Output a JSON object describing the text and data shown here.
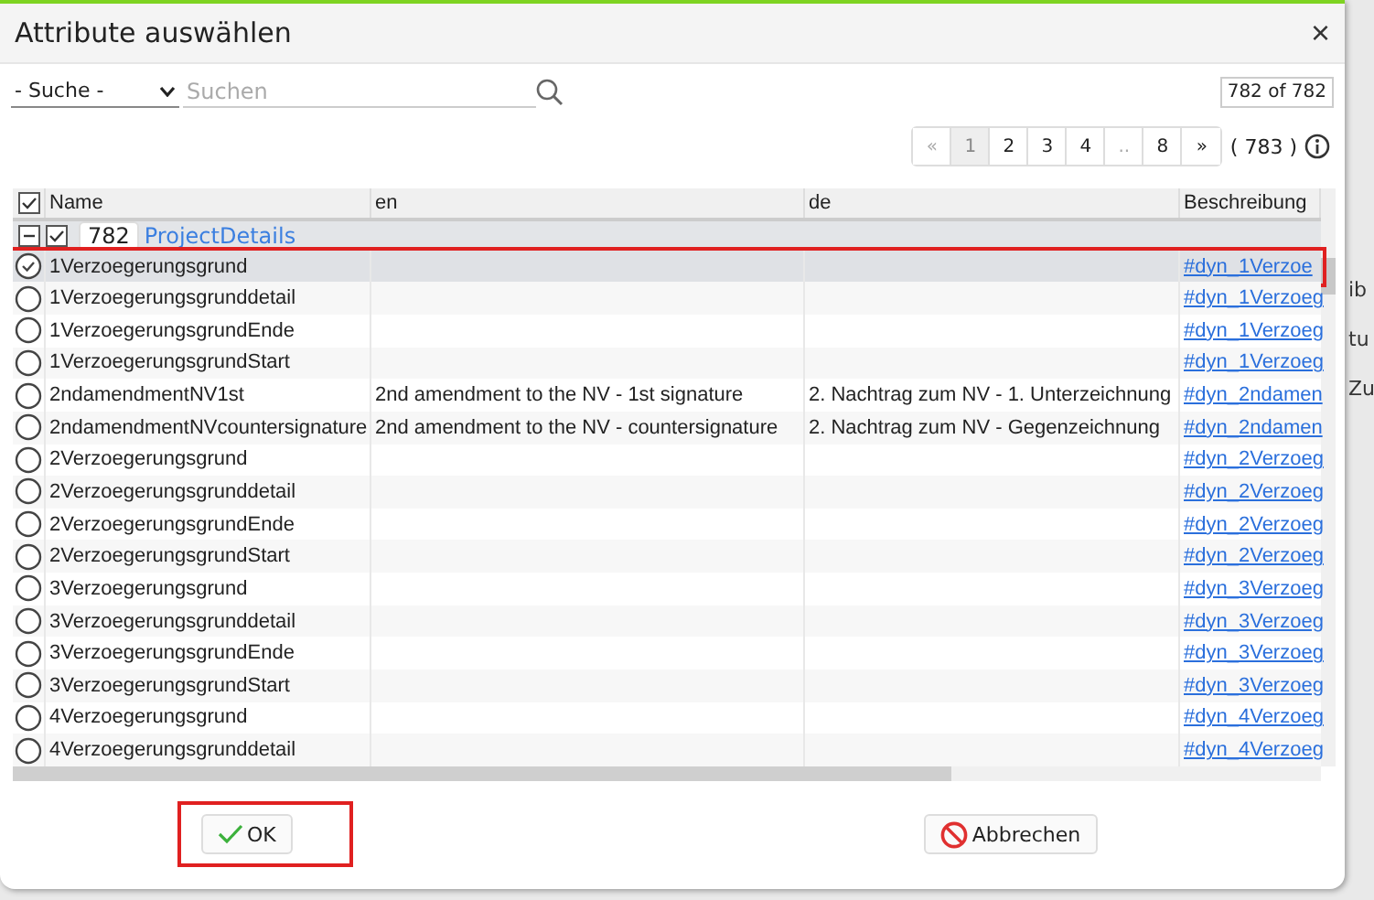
{
  "dialog": {
    "title": "Attribute auswählen",
    "close": "×"
  },
  "search": {
    "scope": "- Suche -",
    "placeholder": "Suchen",
    "count": "782 of 782"
  },
  "pagination": {
    "pages": [
      {
        "label": "«",
        "selected": false,
        "disabled": true
      },
      {
        "label": "1",
        "selected": true,
        "disabled": false
      },
      {
        "label": "2",
        "selected": false,
        "disabled": false
      },
      {
        "label": "3",
        "selected": false,
        "disabled": false
      },
      {
        "label": "4",
        "selected": false,
        "disabled": false
      },
      {
        "label": "..",
        "selected": false,
        "disabled": true
      },
      {
        "label": "8",
        "selected": false,
        "disabled": false
      },
      {
        "label": "»",
        "selected": false,
        "disabled": false
      }
    ],
    "total": "( 783 )"
  },
  "table": {
    "select_all_checked": true,
    "columns": [
      "Name",
      "en",
      "de",
      "Beschreibung"
    ],
    "group": {
      "expanded": true,
      "checked": true,
      "count": "782",
      "name": "ProjectDetails"
    },
    "rows": [
      {
        "name": "1Verzoegerungsgrund",
        "en": "",
        "de": "",
        "description": "#dyn_1Verzoe",
        "selected": true,
        "highlighted": true
      },
      {
        "name": "1Verzoegerungsgrunddetail",
        "en": "",
        "de": "",
        "description": "#dyn_1Verzoeg",
        "selected": false,
        "highlighted": false
      },
      {
        "name": "1VerzoegerungsgrundEnde",
        "en": "",
        "de": "",
        "description": "#dyn_1Verzoeg",
        "selected": false,
        "highlighted": false
      },
      {
        "name": "1VerzoegerungsgrundStart",
        "en": "",
        "de": "",
        "description": "#dyn_1Verzoeg",
        "selected": false,
        "highlighted": false
      },
      {
        "name": "2ndamendmentNV1st",
        "en": "2nd amendment to the NV - 1st signature",
        "de": "2. Nachtrag zum NV - 1. Unterzeichnung",
        "description": "#dyn_2ndamen",
        "selected": false,
        "highlighted": false
      },
      {
        "name": "2ndamendmentNVcountersignature",
        "en": "2nd amendment to the NV - countersignature",
        "de": "2. Nachtrag zum NV - Gegenzeichnung",
        "description": "#dyn_2ndamen",
        "selected": false,
        "highlighted": false
      },
      {
        "name": "2Verzoegerungsgrund",
        "en": "",
        "de": "",
        "description": "#dyn_2Verzoeg",
        "selected": false,
        "highlighted": false
      },
      {
        "name": "2Verzoegerungsgrunddetail",
        "en": "",
        "de": "",
        "description": "#dyn_2Verzoeg",
        "selected": false,
        "highlighted": false
      },
      {
        "name": "2VerzoegerungsgrundEnde",
        "en": "",
        "de": "",
        "description": "#dyn_2Verzoeg",
        "selected": false,
        "highlighted": false
      },
      {
        "name": "2VerzoegerungsgrundStart",
        "en": "",
        "de": "",
        "description": "#dyn_2Verzoeg",
        "selected": false,
        "highlighted": false
      },
      {
        "name": "3Verzoegerungsgrund",
        "en": "",
        "de": "",
        "description": "#dyn_3Verzoeg",
        "selected": false,
        "highlighted": false
      },
      {
        "name": "3Verzoegerungsgrunddetail",
        "en": "",
        "de": "",
        "description": "#dyn_3Verzoeg",
        "selected": false,
        "highlighted": false
      },
      {
        "name": "3VerzoegerungsgrundEnde",
        "en": "",
        "de": "",
        "description": "#dyn_3Verzoeg",
        "selected": false,
        "highlighted": false
      },
      {
        "name": "3VerzoegerungsgrundStart",
        "en": "",
        "de": "",
        "description": "#dyn_3Verzoeg",
        "selected": false,
        "highlighted": false
      },
      {
        "name": "4Verzoegerungsgrund",
        "en": "",
        "de": "",
        "description": "#dyn_4Verzoeg",
        "selected": false,
        "highlighted": false
      },
      {
        "name": "4Verzoegerungsgrunddetail",
        "en": "",
        "de": "",
        "description": "#dyn_4Verzoeg",
        "selected": false,
        "highlighted": false
      }
    ]
  },
  "buttons": [
    {
      "kind": "ok",
      "label": "OK",
      "highlighted": true
    },
    {
      "kind": "cancel",
      "label": "Abbrechen",
      "highlighted": false
    }
  ],
  "background_texts": [
    "ib",
    "tu",
    "Zu"
  ]
}
